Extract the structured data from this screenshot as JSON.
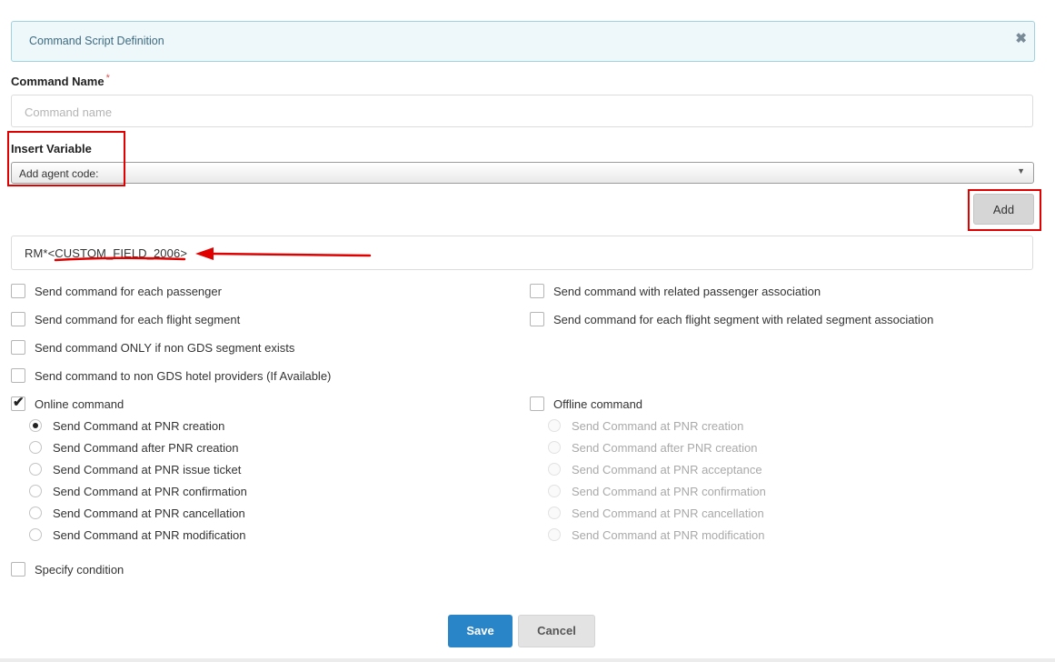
{
  "banner": {
    "title": "Command Script Definition",
    "close_icon": "✖"
  },
  "command_name": {
    "label": "Command Name",
    "required": "*",
    "placeholder": "Command name"
  },
  "insert_variable": {
    "label": "Insert Variable",
    "selected": "Add agent code:"
  },
  "add_button": "Add",
  "command_text": {
    "prefix": "RM*<",
    "variable": "CUSTOM_FIELD_2006",
    "suffix": ">"
  },
  "options_left": [
    {
      "label": "Send command for each passenger",
      "checked": false
    },
    {
      "label": "Send command for each flight segment",
      "checked": false
    },
    {
      "label": "Send command ONLY if non GDS segment exists",
      "checked": false
    },
    {
      "label": "Send command to non GDS hotel providers (If Available)",
      "checked": false
    }
  ],
  "options_right": [
    {
      "label": "Send command with related passenger association",
      "checked": false
    },
    {
      "label": "Send command for each flight segment with related segment association",
      "checked": false
    }
  ],
  "online": {
    "label": "Online command",
    "checked": true,
    "radios": [
      {
        "label": "Send Command at PNR creation",
        "selected": true
      },
      {
        "label": "Send Command after PNR creation",
        "selected": false
      },
      {
        "label": "Send Command at PNR issue ticket",
        "selected": false
      },
      {
        "label": "Send Command at PNR confirmation",
        "selected": false
      },
      {
        "label": "Send Command at PNR cancellation",
        "selected": false
      },
      {
        "label": "Send Command at PNR modification",
        "selected": false
      }
    ]
  },
  "offline": {
    "label": "Offline command",
    "checked": false,
    "radios": [
      {
        "label": "Send Command at PNR creation"
      },
      {
        "label": "Send Command after PNR creation"
      },
      {
        "label": "Send Command at PNR acceptance"
      },
      {
        "label": "Send Command at PNR confirmation"
      },
      {
        "label": "Send Command at PNR cancellation"
      },
      {
        "label": "Send Command at PNR modification"
      }
    ]
  },
  "specify_condition": {
    "label": "Specify condition",
    "checked": false
  },
  "buttons": {
    "save": "Save",
    "cancel": "Cancel"
  },
  "colors": {
    "annotation": "#e00000",
    "primary": "#2a84c8"
  }
}
